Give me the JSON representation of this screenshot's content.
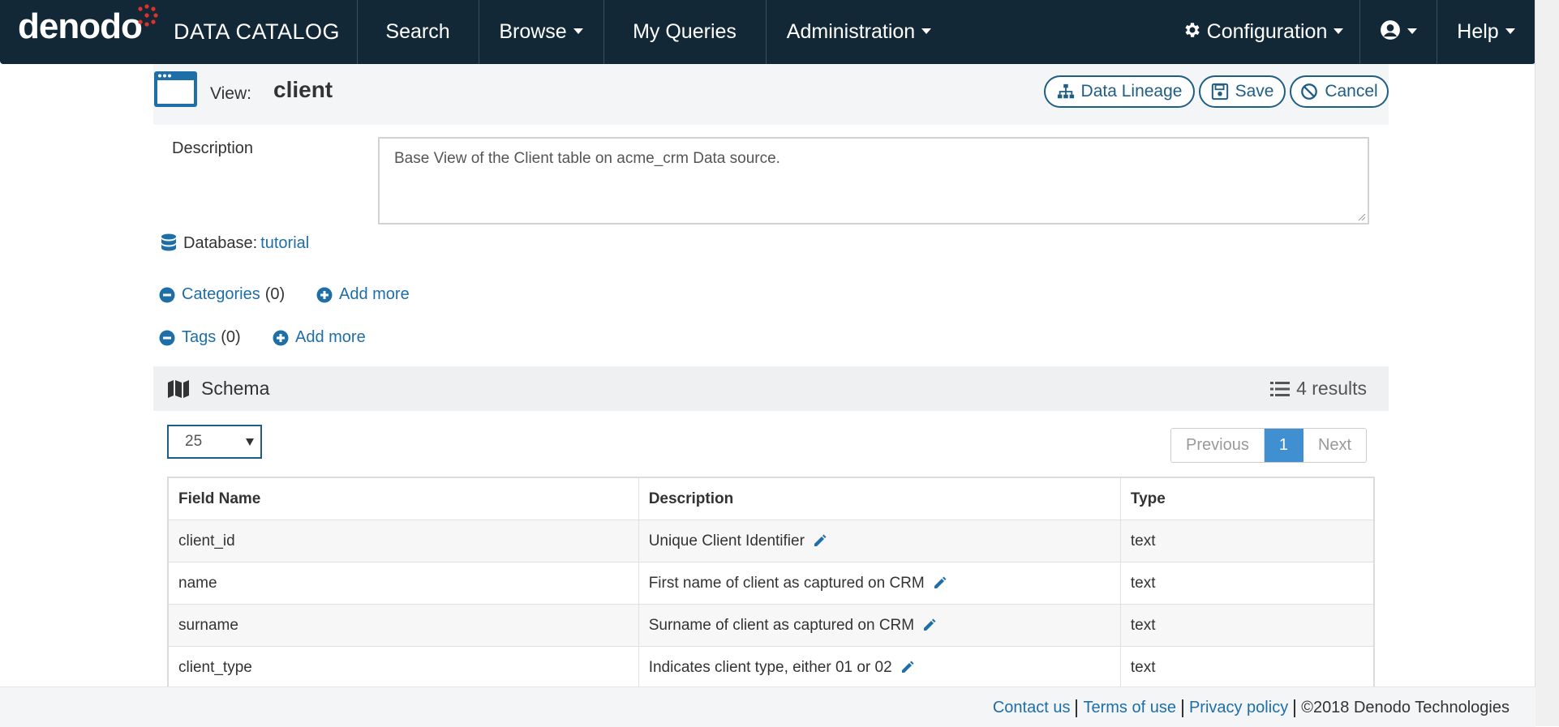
{
  "nav": {
    "logo_text": "denodo",
    "product": "DATA CATALOG",
    "items": [
      {
        "label": "Search"
      },
      {
        "label": "Browse"
      },
      {
        "label": "My Queries"
      },
      {
        "label": "Administration"
      },
      {
        "label": "Configuration"
      },
      {
        "label": "Help"
      }
    ]
  },
  "view": {
    "label": "View:",
    "name": "client",
    "buttons": {
      "lineage": "Data Lineage",
      "save": "Save",
      "cancel": "Cancel"
    }
  },
  "description": {
    "label": "Description",
    "text": "Base View of the Client table on acme_crm Data source."
  },
  "database": {
    "label": "Database:",
    "value": "tutorial"
  },
  "categories": {
    "label": "Categories",
    "count": "(0)",
    "add": "Add more"
  },
  "tags": {
    "label": "Tags",
    "count": "(0)",
    "add": "Add more"
  },
  "schema": {
    "title": "Schema",
    "results": "4 results",
    "page_size": "25",
    "pager": {
      "previous": "Previous",
      "current": "1",
      "next": "Next"
    },
    "columns": [
      "Field Name",
      "Description",
      "Type"
    ],
    "rows": [
      {
        "field": "client_id",
        "description": "Unique Client Identifier",
        "type": "text"
      },
      {
        "field": "name",
        "description": "First name of client as captured on CRM",
        "type": "text"
      },
      {
        "field": "surname",
        "description": "Surname of client as captured on CRM",
        "type": "text"
      },
      {
        "field": "client_type",
        "description": "Indicates client type, either 01 or 02",
        "type": "text"
      }
    ]
  },
  "footer": {
    "contact": "Contact us",
    "terms": "Terms of use",
    "privacy": "Privacy policy",
    "copyright": "©2018 Denodo Technologies"
  },
  "colors": {
    "nav_bg": "#132836",
    "accent": "#1e5d86",
    "link": "#1e6ea8",
    "active_page": "#3f8fd1",
    "logo_dots": "#e0312b"
  }
}
